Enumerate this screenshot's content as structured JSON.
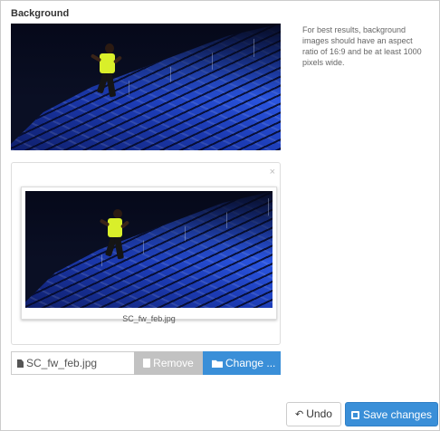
{
  "section": {
    "title": "Background",
    "help_text": "For best results, background images should have an aspect ratio of 16:9 and be at least 1000 pixels wide."
  },
  "preview": {
    "icon": "photo-runner-stadium"
  },
  "uploader": {
    "close_glyph": "×",
    "file_name": "SC_fw_feb.jpg"
  },
  "file_input": {
    "caption": "SC_fw_feb.jpg",
    "remove_label": "Remove",
    "change_label": "Change ...",
    "icons": {
      "file": "file-icon",
      "remove": "trash-icon",
      "change": "folder-open-icon"
    }
  },
  "actions": {
    "undo_label": "Undo",
    "save_label": "Save changes",
    "icons": {
      "undo": "undo-icon",
      "save": "save-icon"
    }
  },
  "colors": {
    "primary": "#3a8fd8",
    "disabled": "#c2c2c2",
    "border": "#cccccc"
  }
}
